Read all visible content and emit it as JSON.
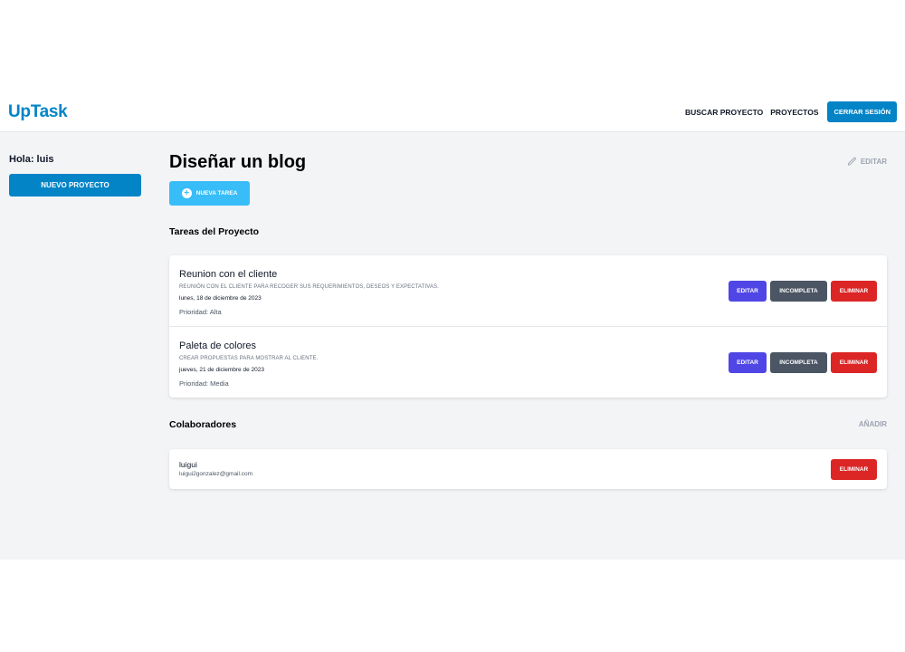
{
  "header": {
    "logo": "UpTask",
    "nav": {
      "search": "Buscar Proyecto",
      "projects": "Proyectos",
      "logout": "Cerrar Sesión"
    }
  },
  "sidebar": {
    "greeting": "Hola: luis",
    "new_project": "Nuevo Proyecto"
  },
  "project": {
    "title": "Diseñar un blog",
    "edit_label": "Editar",
    "new_task_label": "Nueva Tarea"
  },
  "tasks_section": {
    "title": "Tareas del Proyecto",
    "tasks": [
      {
        "name": "Reunion con el cliente",
        "description": "Reunión con el cliente para recoger sus requerimientos, deseos y expectativas.",
        "date": "lunes, 18 de diciembre de 2023",
        "priority": "Prioridad: Alta",
        "edit": "Editar",
        "status": "Incompleta",
        "delete": "Eliminar"
      },
      {
        "name": "Paleta de colores",
        "description": "Crear propuestas para mostrar al cliente.",
        "date": "jueves, 21 de diciembre de 2023",
        "priority": "Prioridad: Media",
        "edit": "Editar",
        "status": "Incompleta",
        "delete": "Eliminar"
      }
    ]
  },
  "collaborators_section": {
    "title": "Colaboradores",
    "add_label": "Añadir",
    "collaborators": [
      {
        "name": "luigui",
        "email": "luigui2gonzalez@gmail.com",
        "delete": "Eliminar"
      }
    ]
  },
  "colors": {
    "brand": "#0284c7",
    "new_task": "#38bdf8",
    "edit": "#4f46e5",
    "status": "#4b5563",
    "delete": "#dc2626",
    "background": "#f3f4f6"
  }
}
